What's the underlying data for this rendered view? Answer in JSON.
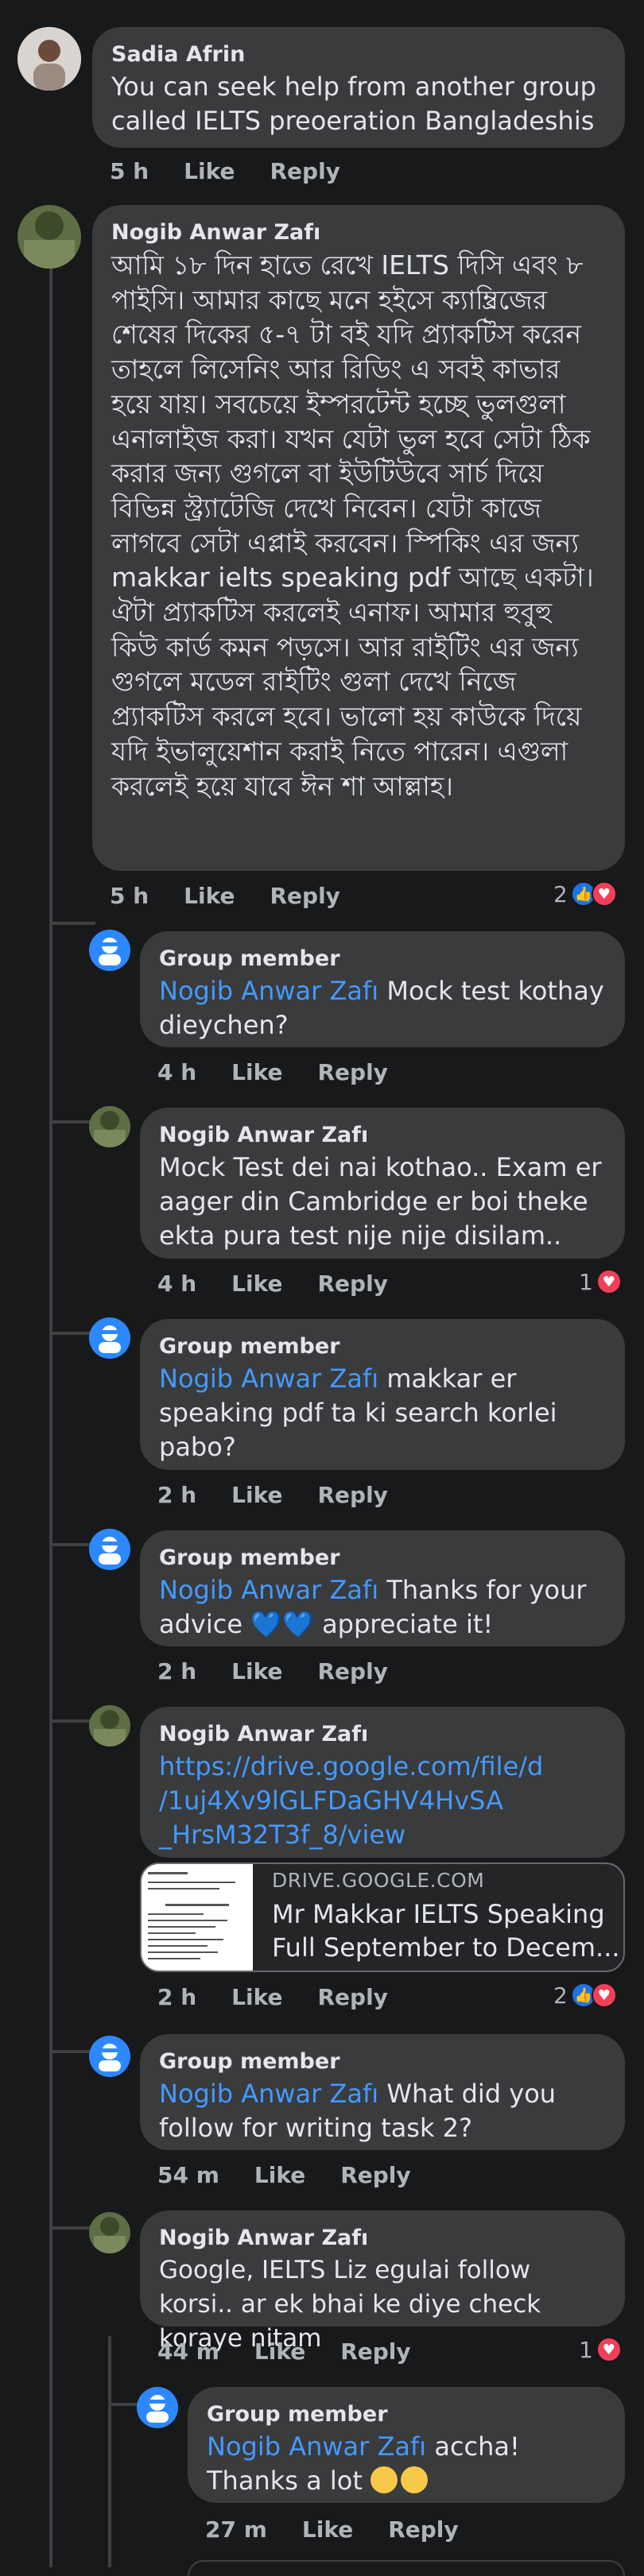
{
  "reaction_icons": {
    "like": "thumbs-up-icon",
    "love": "heart-icon"
  },
  "colors": {
    "background": "#18191a",
    "bubble": "#3a3b3c",
    "mention": "#4599ff",
    "like": "#1b74e4",
    "love": "#f33e58"
  },
  "comments": [
    {
      "author": "Sadia Afrin",
      "text": "You can seek help from another group called IELTS preoeration Bangladeshis",
      "time": "5 h",
      "like": "Like",
      "reply": "Reply"
    },
    {
      "author": "Nogib Anwar Zafı",
      "text": "আমি ১৮ দিন হাতে রেখে IELTS দিসি এবং ৮ পাইসি। আমার কাছে মনে হইসে ক্যাম্ব্রিজের শেষের দিকের ৫-৭ টা বই যদি প্র্যাকটিস করেন তাহলে লিসেনিং আর রিডিং এ সবই কাভার হয়ে যায়। সবচেয়ে ইম্পরটেন্ট হচ্ছে ভুলগুলা এনালাইজ করা। যখন যেটা ভুল হবে সেটা ঠিক করার জন্য গুগলে বা ইউটিউবে সার্চ দিয়ে বিভিন্ন স্ট্র্যাটেজি দেখে নিবেন। যেটা কাজে লাগবে সেটা এপ্লাই করবেন। স্পিকিং এর জন্য makkar ielts speaking pdf আছে একটা। ঐটা প্র্যাকটিস করলেই এনাফ। আমার হুবুহু কিউ কার্ড কমন পড়সে। আর রাইটিং এর জন্য গুগলে মডেল রাইটিং গুলা দেখে নিজে প্র্যাকটিস করলে হবে। ভালো হয় কাউকে দিয়ে যদি ইভালুয়েশান করাই নিতে পারেন। এগুলা করলেই হয়ে যাবে ঈন শা আল্লাহ।",
      "time": "5 h",
      "like": "Like",
      "reply": "Reply",
      "reaction_count": "2"
    },
    {
      "author": "Group member",
      "mention": "Nogib Anwar Zafı",
      "text": " Mock test kothay dieychen?",
      "time": "4 h",
      "like": "Like",
      "reply": "Reply"
    },
    {
      "author": "Nogib Anwar Zafı",
      "text": "Mock Test dei nai kothao.. Exam er aager din Cambridge er boi theke ekta pura test nije nije disilam..",
      "time": "4 h",
      "like": "Like",
      "reply": "Reply",
      "reaction_count": "1"
    },
    {
      "author": "Group member",
      "mention": "Nogib Anwar Zafı",
      "text": " makkar er speaking pdf ta ki search korlei pabo?",
      "time": "2 h",
      "like": "Like",
      "reply": "Reply"
    },
    {
      "author": "Group member",
      "mention": "Nogib Anwar Zafı",
      "text_before": " Thanks for your advice ",
      "text_after": " appreciate it!",
      "time": "2 h",
      "like": "Like",
      "reply": "Reply"
    },
    {
      "author": "Nogib Anwar Zafı",
      "link": "https://drive.google.com/file/d/1uj4Xv9lGLFDaGHV4HvSA_HrsM32T3f_8/view",
      "link_lines": [
        "https://drive.google.com/file/d",
        "/1uj4Xv9lGLFDaGHV4HvSA",
        "_HrsM32T3f_8/view"
      ],
      "preview_domain": "DRIVE.GOOGLE.COM",
      "preview_title": "Mr Makkar IELTS Speaking Full September to Decem...",
      "time": "2 h",
      "like": "Like",
      "reply": "Reply",
      "reaction_count": "2"
    },
    {
      "author": "Group member",
      "mention": "Nogib Anwar Zafı",
      "text": " What did you follow for writing task 2?",
      "time": "54 m",
      "like": "Like",
      "reply": "Reply"
    },
    {
      "author": "Nogib Anwar Zafı",
      "text": "Google, IELTS Liz egulai follow korsi.. ar ek bhai ke diye check koraye nitam",
      "time": "44 m",
      "like": "Like",
      "reply": "Reply",
      "reaction_count": "1"
    },
    {
      "author": "Group member",
      "mention": "Nogib Anwar Zafı",
      "text": " accha! Thanks a lot ",
      "time": "27 m",
      "like": "Like",
      "reply": "Reply"
    }
  ]
}
